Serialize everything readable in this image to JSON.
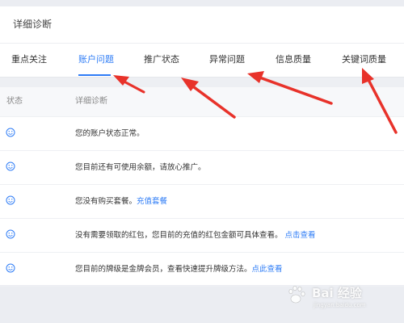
{
  "panel": {
    "title": "详细诊断"
  },
  "tabs": [
    {
      "label": "重点关注",
      "active": false
    },
    {
      "label": "账户问题",
      "active": true
    },
    {
      "label": "推广状态",
      "active": false
    },
    {
      "label": "异常问题",
      "active": false
    },
    {
      "label": "信息质量",
      "active": false
    },
    {
      "label": "关键词质量",
      "active": false
    }
  ],
  "table": {
    "headers": {
      "status": "状态",
      "diagnosis": "详细诊断"
    },
    "rows": [
      {
        "status_icon": "smile-icon",
        "text": "您的账户状态正常。",
        "link": ""
      },
      {
        "status_icon": "smile-icon",
        "text": "您目前还有可使用余额，请放心推广。",
        "link": ""
      },
      {
        "status_icon": "smile-icon",
        "text": "您没有购买套餐。",
        "link": "充值套餐"
      },
      {
        "status_icon": "smile-icon",
        "text": "没有需要领取的红包，您目前的充值的红包金额可具体查看。",
        "link": "点击查看"
      },
      {
        "status_icon": "smile-icon",
        "text": "您目前的牌级是金牌会员，查看快速提升牌级方法。",
        "link": "点此查看"
      }
    ]
  },
  "watermark": {
    "main": "Bai 经验",
    "sub": "jingyan.baidu.com"
  },
  "colors": {
    "accent": "#2e7cf6",
    "arrow": "#e8322a",
    "page_bg": "#ebedf2"
  }
}
